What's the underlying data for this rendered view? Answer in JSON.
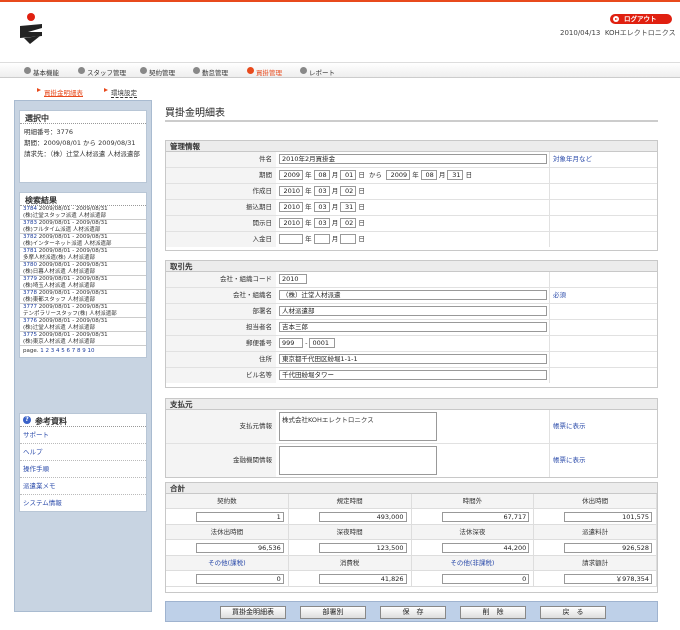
{
  "header": {
    "logout": "ログアウト",
    "date": "2010/04/13",
    "company": "KOHエレクトロニクス"
  },
  "nav": [
    "基本機能",
    "スタッフ管理",
    "契約管理",
    "勤怠管理",
    "買掛管理",
    "レポート"
  ],
  "subnav": [
    "買掛金明細表",
    "環境設定"
  ],
  "sidebar": {
    "selected": {
      "title": "選択中",
      "number": "明細番号：3776",
      "period": "期間：2009/08/01 から 2009/08/31",
      "client": "請求先：（株）辻堂人材派遣 人材派遣部"
    },
    "results": {
      "title": "検索結果",
      "items": [
        {
          "id": "3784",
          "date": " 2009/08/01 - 2009/08/31",
          "name": "(株)辻堂スタッフ派遣 人材派遣部"
        },
        {
          "id": "3783",
          "date": " 2009/08/01 - 2009/08/31",
          "name": "(株)フルタイム派遣 人材派遣部"
        },
        {
          "id": "3782",
          "date": " 2009/08/01 - 2009/08/31",
          "name": "(株)インターネット派遣 人材派遣部"
        },
        {
          "id": "3781",
          "date": " 2009/08/01 - 2009/08/31",
          "name": "多摩人材派遣(株) 人材派遣部"
        },
        {
          "id": "3780",
          "date": " 2009/08/01 - 2009/08/31",
          "name": "(株)日暮人材派遣 人材派遣部"
        },
        {
          "id": "3779",
          "date": " 2009/08/01 - 2009/08/31",
          "name": "(株)埼玉人材派遣 人材派遣部"
        },
        {
          "id": "3778",
          "date": " 2009/08/01 - 2009/08/31",
          "name": "(株)東都スタッフ 人材派遣部"
        },
        {
          "id": "3777",
          "date": " 2009/08/01 - 2009/08/31",
          "name": "テンポラリースタッフ(株) 人材派遣部"
        },
        {
          "id": "3776",
          "date": " 2009/08/01 - 2009/08/31",
          "name": "(株)辻堂人材派遣 人材派遣部"
        },
        {
          "id": "3775",
          "date": " 2009/08/01 - 2009/08/31",
          "name": "(株)東京人材派遣 人材派遣部"
        }
      ],
      "page_label": "page.",
      "pages": "1 2 3 4 5 6 7 8 9 10"
    },
    "refs": {
      "title": "参考資料",
      "items": [
        "サポート",
        "ヘルプ",
        "操作手順",
        "派遣業メモ",
        "システム情報"
      ]
    }
  },
  "main": {
    "title": "買掛金明細表",
    "mgmt": {
      "title": "管理情報",
      "name_lbl": "件名",
      "name": "2010年2月買掛金",
      "name_link": "対象年月など",
      "period_lbl": "期間",
      "p_from": [
        "2009",
        "08",
        "01"
      ],
      "kara": "から",
      "p_to": [
        "2009",
        "08",
        "31"
      ],
      "created_lbl": "作成日",
      "created": [
        "2010",
        "03",
        "02"
      ],
      "due_lbl": "振込期日",
      "due": [
        "2010",
        "03",
        "31"
      ],
      "open_lbl": "開示日",
      "open": [
        "2010",
        "03",
        "02"
      ],
      "pay_lbl": "入金日",
      "pay": [
        "",
        "",
        ""
      ],
      "y": "年",
      "m": "月",
      "d": "日"
    },
    "client": {
      "title": "取引先",
      "code_lbl": "会社・組織コード",
      "code": "2010",
      "org_lbl": "会社・組織名",
      "org": "（株）辻堂人材派遣",
      "req": "必須",
      "dept_lbl": "部署名",
      "dept": "人材派遣部",
      "person_lbl": "担当者名",
      "person": "吉本三郎",
      "zip_lbl": "郵便番号",
      "zip1": "999",
      "zip2": "0001",
      "addr_lbl": "住所",
      "addr": "東京都千代田区紛堀1-1-1",
      "bld_lbl": "ビル名等",
      "bld": "千代田紛堀タワー"
    },
    "payer": {
      "title": "支払元",
      "info_lbl": "支払元情報",
      "info": "株式会社KOHエレクトロニクス",
      "info_link": "帳票に表示",
      "bank_lbl": "金融機関情報",
      "bank": "",
      "bank_link": "帳票に表示"
    },
    "total": {
      "title": "合計",
      "rows": [
        {
          "h": [
            "契約数",
            "規定時間",
            "時間外",
            "休出時間"
          ],
          "v": [
            "1",
            "493,000",
            "67,717",
            "101,575"
          ]
        },
        {
          "h": [
            "法休出時間",
            "深夜時間",
            "法休深夜",
            "派遣料計"
          ],
          "v": [
            "96,536",
            "123,500",
            "44,200",
            "926,528"
          ]
        },
        {
          "h": [
            "その他(課税)",
            "消費税",
            "その他(非課税)",
            "請求額計"
          ],
          "v": [
            "0",
            "41,826",
            "0",
            "￥978,354"
          ]
        }
      ]
    },
    "buttons": [
      "買掛金明細表",
      "部署別",
      "保　存",
      "削　除",
      "戻　る"
    ]
  }
}
